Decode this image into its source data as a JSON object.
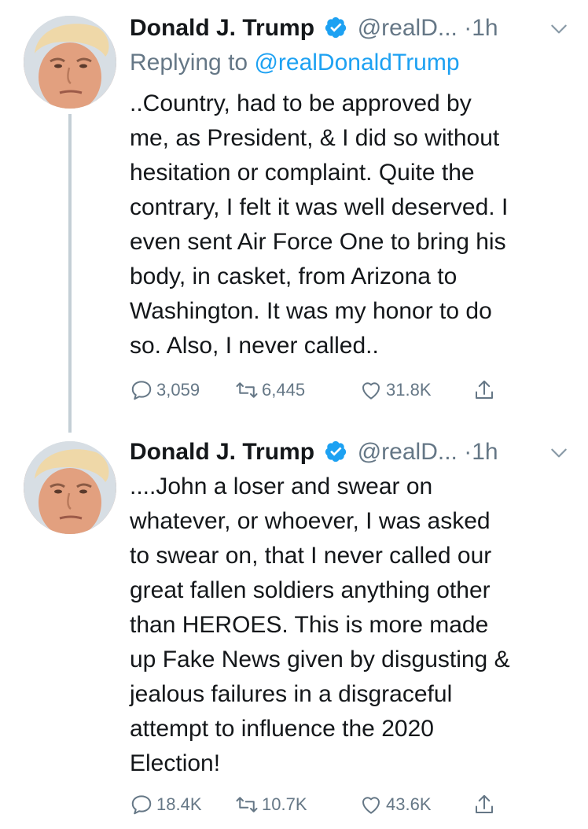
{
  "tweets": [
    {
      "display_name": "Donald J. Trump",
      "handle": "@realD...",
      "dot": "·",
      "time": "1h",
      "replying_prefix": "Replying to ",
      "replying_handle": "@realDonaldTrump",
      "text": "..Country, had to be approved by\nme, as President, & I did so without\nhesitation  or complaint. Quite the\ncontrary, I felt it was well deserved. I\neven sent Air Force One to bring his\nbody, in casket, from Arizona to\nWashington. It was my honor to do\nso. Also, I never called..",
      "replies": "3,059",
      "retweets": "6,445",
      "likes": "31.8K"
    },
    {
      "display_name": "Donald J. Trump",
      "handle": "@realD...",
      "dot": "·",
      "time": "1h",
      "text": "....John a loser and swear on\nwhatever, or whoever, I was asked\nto swear on, that I never called our\ngreat fallen soldiers anything other\nthan HEROES. This is more made\nup Fake News given by disgusting &\njealous failures in a disgraceful\nattempt to influence the 2020\nElection!",
      "replies": "18.4K",
      "retweets": "10.7K",
      "likes": "43.6K"
    }
  ],
  "icons": {
    "verified": "verified-badge-icon",
    "chevron": "chevron-down-icon",
    "reply": "reply-bubble-icon",
    "retweet": "retweet-icon",
    "like": "heart-icon",
    "share": "share-upload-icon"
  },
  "colors": {
    "text": "#14171a",
    "secondary": "#657786",
    "accent": "#1da1f2",
    "thread_line": "#c4cfd6"
  }
}
